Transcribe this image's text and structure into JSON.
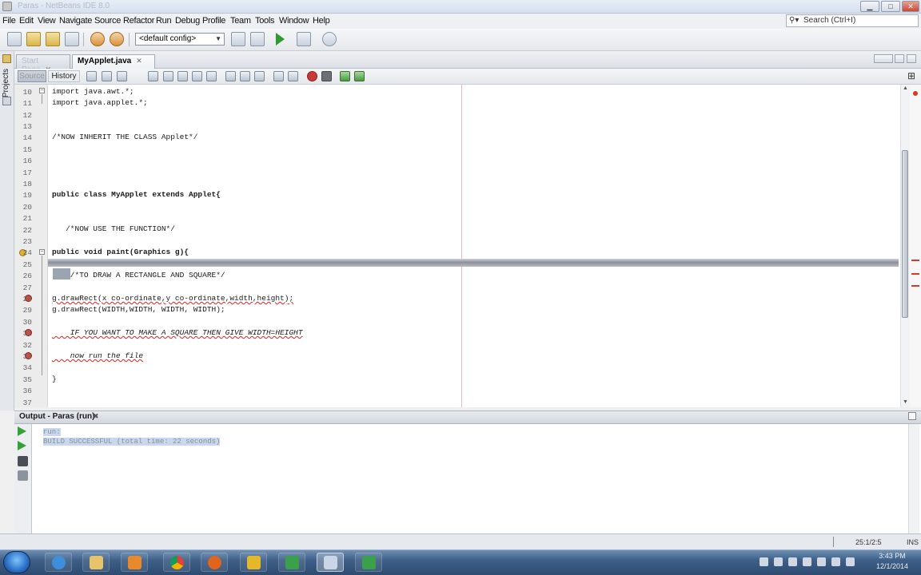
{
  "window": {
    "title": "Paras - NetBeans IDE 8.0"
  },
  "menu": [
    "File",
    "Edit",
    "View",
    "Navigate",
    "Source",
    "Refactor",
    "Run",
    "Debug",
    "Profile",
    "Team",
    "Tools",
    "Window",
    "Help"
  ],
  "search": {
    "placeholder": "Search (Ctrl+I)"
  },
  "toolbar": {
    "config": "<default config>"
  },
  "left_strip": {
    "projects": "Projects"
  },
  "tabs": [
    {
      "label": "Start Page",
      "active": false
    },
    {
      "label": "MyApplet.java",
      "active": true
    }
  ],
  "editor_toolbar": {
    "source": "Source",
    "history": "History"
  },
  "code": [
    {
      "no": "10",
      "text": "import java.awt.*;"
    },
    {
      "no": "11",
      "text": "import java.applet.*;"
    },
    {
      "no": "12",
      "text": ""
    },
    {
      "no": "13",
      "text": ""
    },
    {
      "no": "14",
      "text": "/*NOW INHERIT THE CLASS Applet*/"
    },
    {
      "no": "15",
      "text": ""
    },
    {
      "no": "16",
      "text": ""
    },
    {
      "no": "17",
      "text": ""
    },
    {
      "no": "18",
      "text": ""
    },
    {
      "no": "19",
      "text": "public class MyApplet extends Applet{"
    },
    {
      "no": "20",
      "text": ""
    },
    {
      "no": "21",
      "text": ""
    },
    {
      "no": "22",
      "text": "   /*NOW USE THE FUNCTION*/"
    },
    {
      "no": "23",
      "text": ""
    },
    {
      "no": "24",
      "text": "public void paint(Graphics g){"
    },
    {
      "no": "25",
      "text": ""
    },
    {
      "no": "26",
      "text": "    /*TO DRAW A RECTANGLE AND SQUARE*/"
    },
    {
      "no": "27",
      "text": ""
    },
    {
      "no": "28",
      "text": "g.drawRect(x co-ordinate,y co-ordinate,width,height);"
    },
    {
      "no": "29",
      "text": "g.drawRect(WIDTH,WIDTH, WIDTH, WIDTH);"
    },
    {
      "no": "30",
      "text": ""
    },
    {
      "no": "31",
      "text": "    IF YOU WANT TO MAKE A SQUARE THEN GIVE WIDTH=HEIGHT"
    },
    {
      "no": "32",
      "text": ""
    },
    {
      "no": "33",
      "text": "    now run the file"
    },
    {
      "no": "34",
      "text": ""
    },
    {
      "no": "35",
      "text": "}"
    },
    {
      "no": "36",
      "text": ""
    },
    {
      "no": "37",
      "text": ""
    }
  ],
  "output": {
    "title": "Output - Paras (run)",
    "lines": [
      "run:",
      "BUILD SUCCESSFUL (total time: 22 seconds)"
    ]
  },
  "status": {
    "position": "25:1/2:5",
    "mode": "INS"
  },
  "taskbar": {
    "time": "3:43 PM",
    "date": "12/1/2014"
  }
}
